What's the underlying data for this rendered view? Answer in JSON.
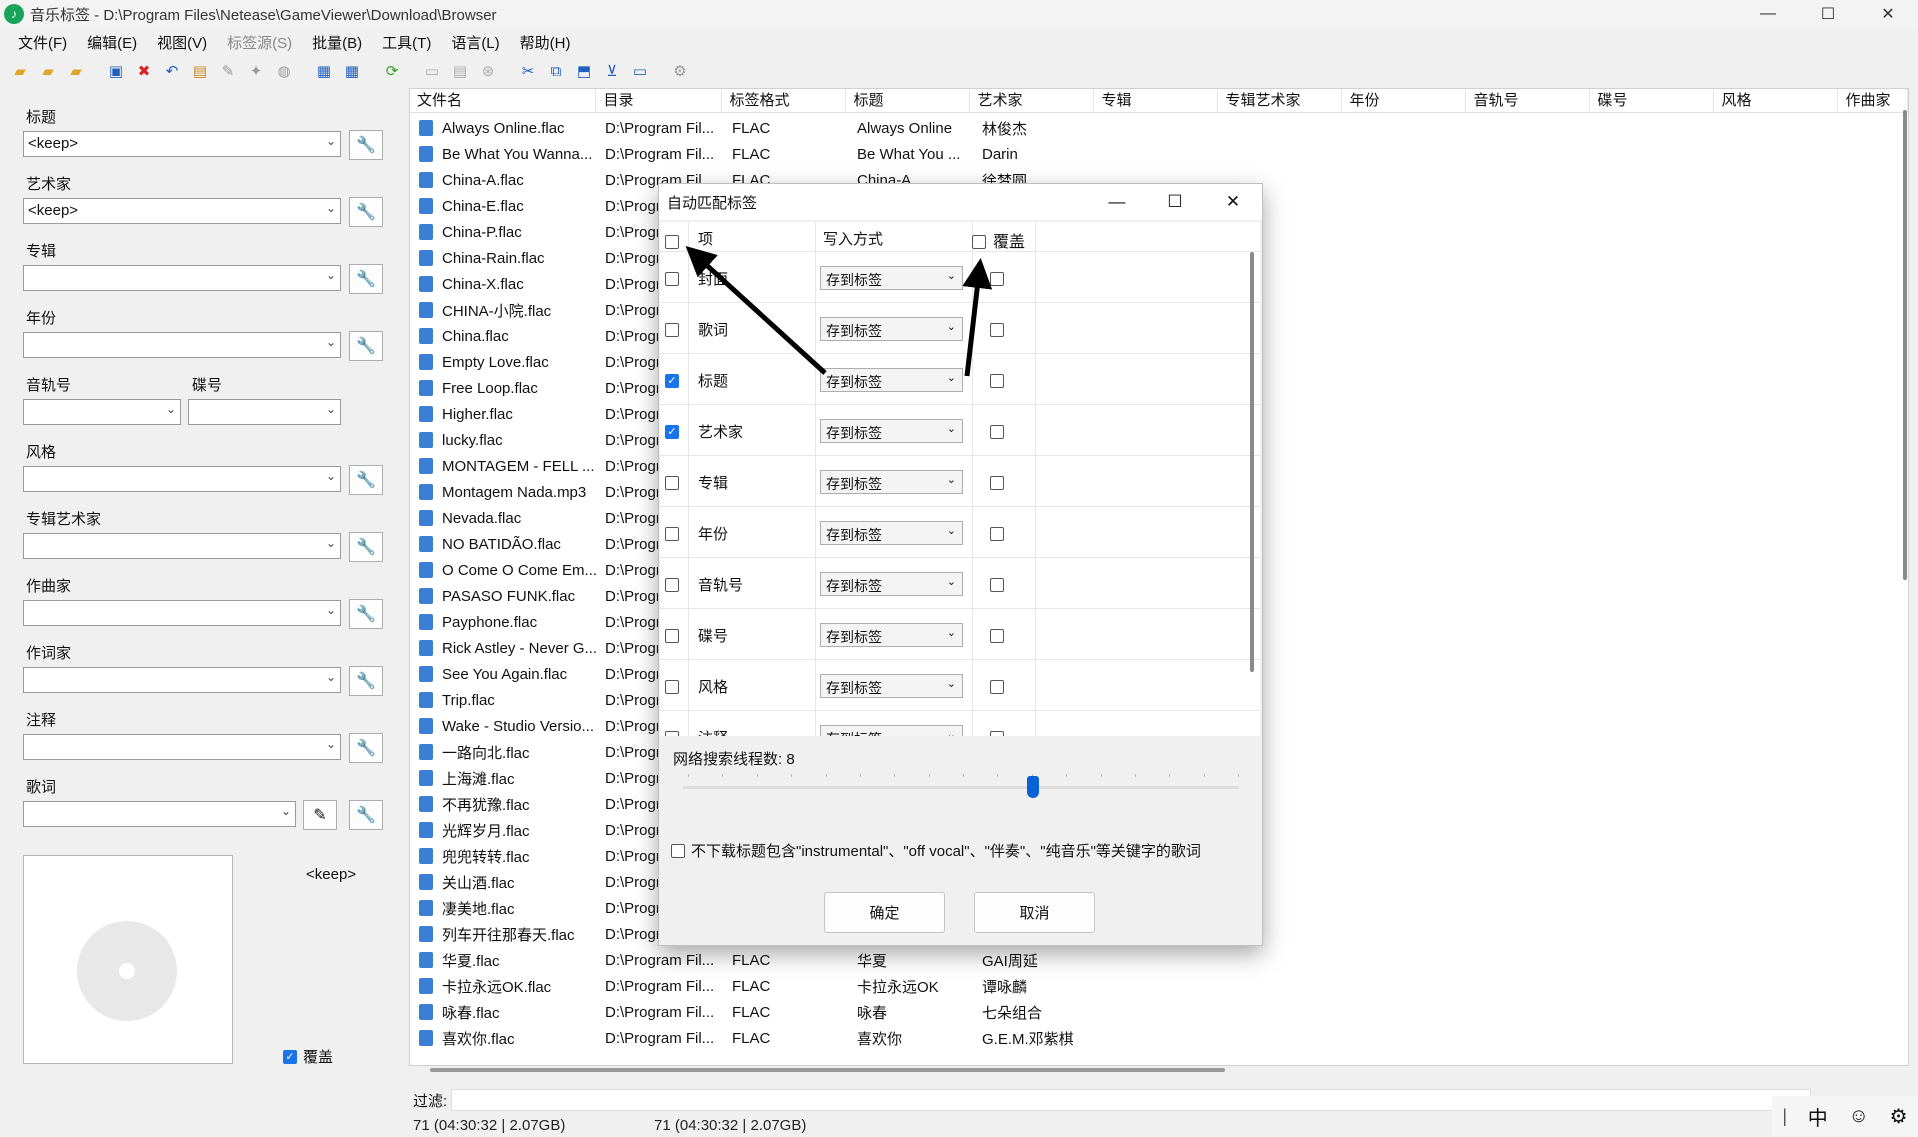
{
  "window": {
    "title": "音乐标签 - D:\\Program Files\\Netease\\GameViewer\\Download\\Browser",
    "minimize": "—",
    "maximize": "☐",
    "close": "✕"
  },
  "menu": [
    "文件(F)",
    "编辑(E)",
    "视图(V)",
    "标签源(S)",
    "批量(B)",
    "工具(T)",
    "语言(L)",
    "帮助(H)"
  ],
  "left": {
    "labels": {
      "title": "标题",
      "artist": "艺术家",
      "album": "专辑",
      "year": "年份",
      "track": "音轨号",
      "disc": "碟号",
      "genre": "风格",
      "album_artist": "专辑艺术家",
      "composer": "作曲家",
      "lyricist": "作词家",
      "comment": "注释",
      "lyrics": "歌词"
    },
    "title_value": "<keep>",
    "artist_value": "<keep>",
    "cover_keep": "<keep>",
    "overwrite": "覆盖",
    "overwrite_checked": true
  },
  "list": {
    "columns": [
      "文件名",
      "目录",
      "标签格式",
      "标题",
      "艺术家",
      "专辑",
      "专辑艺术家",
      "年份",
      "音轨号",
      "碟号",
      "风格",
      "作曲家"
    ],
    "rows": [
      [
        "Always Online.flac",
        "D:\\Program Fil...",
        "FLAC",
        "Always Online",
        "林俊杰"
      ],
      [
        "Be What You Wanna...",
        "D:\\Program Fil...",
        "FLAC",
        "Be What You ...",
        "Darin"
      ],
      [
        "China-A.flac",
        "D:\\Program Fil...",
        "FLAC",
        "China-A",
        "徐梦圆"
      ],
      [
        "China-E.flac",
        "D:\\Progr",
        "",
        "",
        ""
      ],
      [
        "China-P.flac",
        "D:\\Progr",
        "",
        "",
        ""
      ],
      [
        "China-Rain.flac",
        "D:\\Progr",
        "",
        "",
        ""
      ],
      [
        "China-X.flac",
        "D:\\Progr",
        "",
        "",
        ""
      ],
      [
        "CHINA-小院.flac",
        "D:\\Progr",
        "",
        "",
        ""
      ],
      [
        "China.flac",
        "D:\\Progr",
        "",
        "",
        ""
      ],
      [
        "Empty Love.flac",
        "D:\\Progr",
        "",
        "",
        ""
      ],
      [
        "Free Loop.flac",
        "D:\\Progr",
        "",
        "",
        ""
      ],
      [
        "Higher.flac",
        "D:\\Progr",
        "",
        "",
        ""
      ],
      [
        "lucky.flac",
        "D:\\Progr",
        "",
        "",
        ""
      ],
      [
        "MONTAGEM - FELL ...",
        "D:\\Progr",
        "",
        "",
        ""
      ],
      [
        "Montagem Nada.mp3",
        "D:\\Progr",
        "",
        "",
        ""
      ],
      [
        "Nevada.flac",
        "D:\\Progr",
        "",
        "",
        ""
      ],
      [
        "NO BATIDÃO.flac",
        "D:\\Progr",
        "",
        "",
        ""
      ],
      [
        "O Come O Come Em...",
        "D:\\Progr",
        "",
        "",
        ""
      ],
      [
        "PASASO FUNK.flac",
        "D:\\Progr",
        "",
        "",
        ""
      ],
      [
        "Payphone.flac",
        "D:\\Progr",
        "",
        "",
        ""
      ],
      [
        "Rick Astley - Never G...",
        "D:\\Progr",
        "",
        "",
        ""
      ],
      [
        "See You Again.flac",
        "D:\\Progr",
        "",
        "",
        ""
      ],
      [
        "Trip.flac",
        "D:\\Progr",
        "",
        "",
        ""
      ],
      [
        "Wake - Studio Versio...",
        "D:\\Progr",
        "",
        "",
        ""
      ],
      [
        "一路向北.flac",
        "D:\\Progr",
        "",
        "",
        ""
      ],
      [
        "上海滩.flac",
        "D:\\Progr",
        "",
        "",
        ""
      ],
      [
        "不再犹豫.flac",
        "D:\\Progr",
        "",
        "",
        ""
      ],
      [
        "光辉岁月.flac",
        "D:\\Progr",
        "",
        "",
        ""
      ],
      [
        "兜兜转转.flac",
        "D:\\Progr",
        "",
        "",
        ""
      ],
      [
        "关山酒.flac",
        "D:\\Progr",
        "",
        "",
        ""
      ],
      [
        "凄美地.flac",
        "D:\\Progr",
        "",
        "",
        ""
      ],
      [
        "列车开往那春天.flac",
        "D:\\Progr",
        "",
        "",
        ""
      ],
      [
        "华夏.flac",
        "D:\\Program Fil...",
        "FLAC",
        "华夏",
        "GAI周延"
      ],
      [
        "卡拉永远OK.flac",
        "D:\\Program Fil...",
        "FLAC",
        "卡拉永远OK",
        "谭咏麟"
      ],
      [
        "咏春.flac",
        "D:\\Program Fil...",
        "FLAC",
        "咏春",
        "七朵组合"
      ],
      [
        "喜欢你.flac",
        "D:\\Program Fil...",
        "FLAC",
        "喜欢你",
        "G.E.M.邓紫棋"
      ]
    ]
  },
  "filter": {
    "label": "过滤:"
  },
  "status": {
    "left": "71 (04:30:32 | 2.07GB)",
    "right": "71 (04:30:32 | 2.07GB)"
  },
  "ime": {
    "mode": "中",
    "emoji": "☺",
    "settings": "⚙"
  },
  "dialog": {
    "title": "自动匹配标签",
    "header": {
      "item": "项",
      "write": "写入方式",
      "overwrite": "覆盖"
    },
    "rows": [
      {
        "label": "封面",
        "checked": false,
        "write": "存到标签"
      },
      {
        "label": "歌词",
        "checked": false,
        "write": "存到标签"
      },
      {
        "label": "标题",
        "checked": true,
        "write": "存到标签"
      },
      {
        "label": "艺术家",
        "checked": true,
        "write": "存到标签"
      },
      {
        "label": "专辑",
        "checked": false,
        "write": "存到标签"
      },
      {
        "label": "年份",
        "checked": false,
        "write": "存到标签"
      },
      {
        "label": "音轨号",
        "checked": false,
        "write": "存到标签"
      },
      {
        "label": "碟号",
        "checked": false,
        "write": "存到标签"
      },
      {
        "label": "风格",
        "checked": false,
        "write": "存到标签"
      },
      {
        "label": "注释",
        "checked": false,
        "write": "存到标签"
      }
    ],
    "threads_label": "网络搜索线程数: 8",
    "threads_value": 8,
    "threads_max": 16,
    "no_lyrics_text": "不下载标题包含\"instrumental\"、\"off vocal\"、\"伴奏\"、\"纯音乐\"等关键字的歌词",
    "ok": "确定",
    "cancel": "取消"
  },
  "colors": {
    "accent": "#0a63d6",
    "arrow": "#000000"
  }
}
